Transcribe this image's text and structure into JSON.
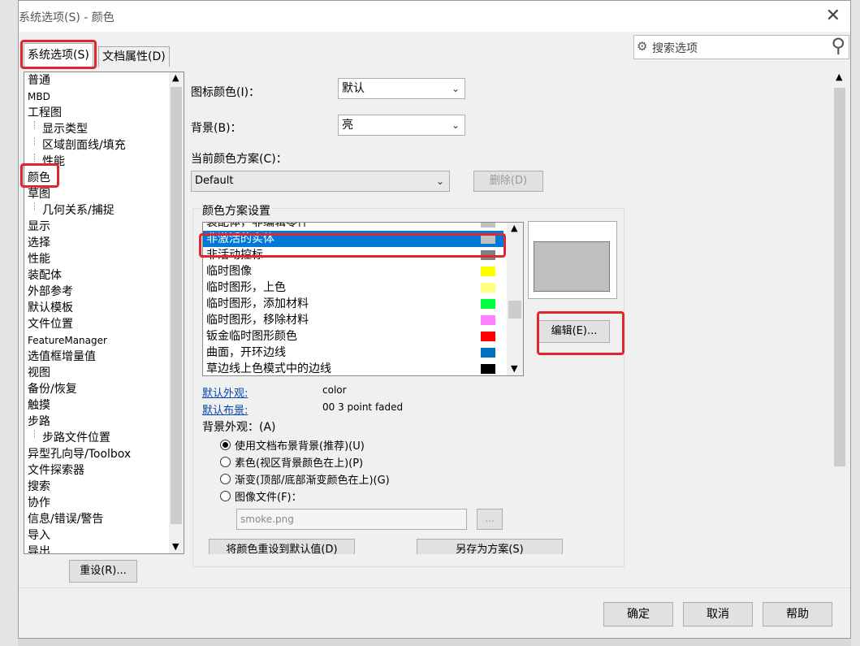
{
  "window": {
    "title": "系统选项(S) - 颜色"
  },
  "tabs": {
    "system_options": "系统选项(S)",
    "document_properties": "文档属性(D)"
  },
  "search": {
    "placeholder": "搜索选项"
  },
  "tree": {
    "items": [
      {
        "label": "普通",
        "level": 0
      },
      {
        "label": "MBD",
        "level": 0,
        "small": true
      },
      {
        "label": "工程图",
        "level": 0
      },
      {
        "label": "显示类型",
        "level": 1
      },
      {
        "label": "区域剖面线/填充",
        "level": 1
      },
      {
        "label": "性能",
        "level": 1
      },
      {
        "label": "颜色",
        "level": 0,
        "selected": true
      },
      {
        "label": "草图",
        "level": 0
      },
      {
        "label": "几何关系/捕捉",
        "level": 1
      },
      {
        "label": "显示",
        "level": 0
      },
      {
        "label": "选择",
        "level": 0
      },
      {
        "label": "性能",
        "level": 0
      },
      {
        "label": "装配体",
        "level": 0
      },
      {
        "label": "外部参考",
        "level": 0
      },
      {
        "label": "默认模板",
        "level": 0
      },
      {
        "label": "文件位置",
        "level": 0
      },
      {
        "label": "FeatureManager",
        "level": 0,
        "small": true
      },
      {
        "label": "选值框增量值",
        "level": 0
      },
      {
        "label": "视图",
        "level": 0
      },
      {
        "label": "备份/恢复",
        "level": 0
      },
      {
        "label": "触摸",
        "level": 0
      },
      {
        "label": "步路",
        "level": 0
      },
      {
        "label": "步路文件位置",
        "level": 1
      },
      {
        "label": "异型孔向导/Toolbox",
        "level": 0
      },
      {
        "label": "文件探索器",
        "level": 0
      },
      {
        "label": "搜索",
        "level": 0
      },
      {
        "label": "协作",
        "level": 0
      },
      {
        "label": "信息/错误/警告",
        "level": 0
      },
      {
        "label": "导入",
        "level": 0
      },
      {
        "label": "导出",
        "level": 0
      }
    ]
  },
  "reset_button": "重设(R)...",
  "icon_color": {
    "label": "图标颜色(I)：",
    "value": "默认"
  },
  "background": {
    "label": "背景(B)：",
    "value": "亮"
  },
  "scheme": {
    "label": "当前颜色方案(C)：",
    "value": "Default",
    "delete_button": "删除(D)"
  },
  "scheme_settings": {
    "title": "颜色方案设置",
    "rows": [
      {
        "label": "装配体，非编辑零件",
        "color": "#c0c0c0"
      },
      {
        "label": "非激活的实体",
        "color": "#c0c0c0",
        "selected": true
      },
      {
        "label": "非活动控标",
        "color": "#808080"
      },
      {
        "label": "临时图像",
        "color": "#ffff00"
      },
      {
        "label": "临时图形，上色",
        "color": "#ffff80"
      },
      {
        "label": "临时图形，添加材料",
        "color": "#00ff40"
      },
      {
        "label": "临时图形，移除材料",
        "color": "#ff80ff"
      },
      {
        "label": "钣金临时图形颜色",
        "color": "#ff0000"
      },
      {
        "label": "曲面，开环边线",
        "color": "#0070c0"
      },
      {
        "label": "草边线上色模式中的边线",
        "color": "#000000"
      }
    ],
    "preview_color": "#c0c0c0",
    "edit_button": "编辑(E)..."
  },
  "defaults": {
    "appearance_label": "默认外观:",
    "appearance_value": "color",
    "layout_label": "默认布景:",
    "layout_value": "00 3 point faded"
  },
  "bg_appearance": {
    "label": "背景外观：(A)",
    "options": [
      {
        "label": "使用文档布景背景(推荐)(U)",
        "checked": true
      },
      {
        "label": "素色(视区背景颜色在上)(P)",
        "checked": false
      },
      {
        "label": "渐变(顶部/底部渐变颜色在上)(G)",
        "checked": false
      },
      {
        "label": "图像文件(F)：",
        "checked": false
      }
    ],
    "image_file": "smoke.png",
    "browse_button": "..."
  },
  "bottom_buttons": {
    "reset_colors": "将颜色重设到默认值(D)",
    "save_scheme": "另存为方案(S)"
  },
  "dialog_buttons": {
    "ok": "确定",
    "cancel": "取消",
    "help": "帮助"
  }
}
